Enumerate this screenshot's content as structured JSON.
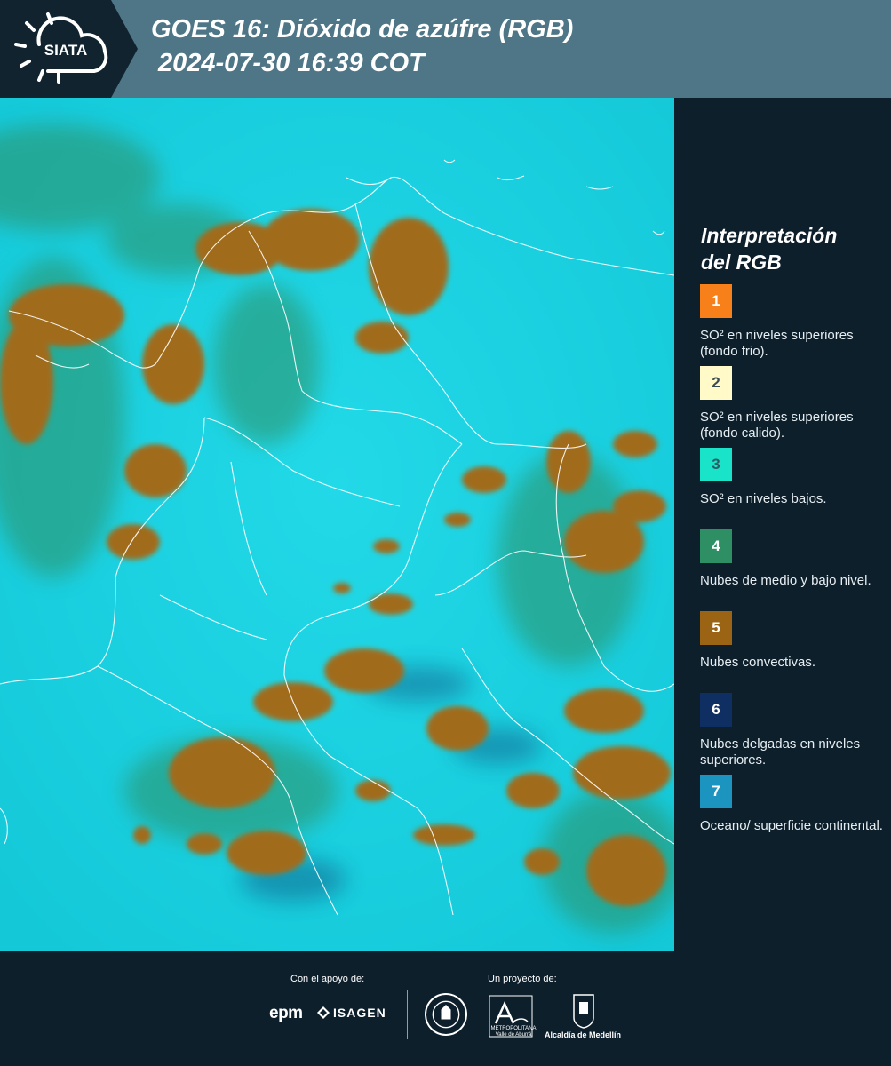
{
  "header": {
    "logo_text": "SIATA",
    "title_line1": "GOES 16: Dióxido de azúfre (RGB)",
    "title_line2": "2024-07-30 16:39 COT"
  },
  "legend": {
    "title_line1": "Interpretación",
    "title_line2": "del RGB",
    "items": [
      {
        "number": "1",
        "color": "#f7801a",
        "text_color": "#ffffff",
        "text": "SO² en niveles superiores (fondo frio)."
      },
      {
        "number": "2",
        "color": "#fffac8",
        "text_color": "#3a4a55",
        "text": "SO² en niveles superiores (fondo calido)."
      },
      {
        "number": "3",
        "color": "#19e3c9",
        "text_color": "#2a5d63",
        "text": "SO² en niveles bajos."
      },
      {
        "number": "4",
        "color": "#2e8f64",
        "text_color": "#ffffff",
        "text": "Nubes de medio y bajo nivel."
      },
      {
        "number": "5",
        "color": "#9a6414",
        "text_color": "#ffffff",
        "text": "Nubes convectivas."
      },
      {
        "number": "6",
        "color": "#0f2f63",
        "text_color": "#ffffff",
        "text": "Nubes delgadas en niveles superiores."
      },
      {
        "number": "7",
        "color": "#1b95bf",
        "text_color": "#ffffff",
        "text": "Oceano/ superficie continental."
      }
    ]
  },
  "footer": {
    "support_label": "Con el apoyo de:",
    "project_label": "Un proyecto de:",
    "epm": "epm",
    "isagen": "ISAGEN",
    "area_text": "METROPOLITANA Valle de Aburrá",
    "alcaldia": "Alcaldía de Medellín"
  },
  "colors": {
    "ocean": "#1ad7e6",
    "convective": "#a06c1c",
    "midlevel": "#2e8f64",
    "thin": "#0f2f63"
  }
}
